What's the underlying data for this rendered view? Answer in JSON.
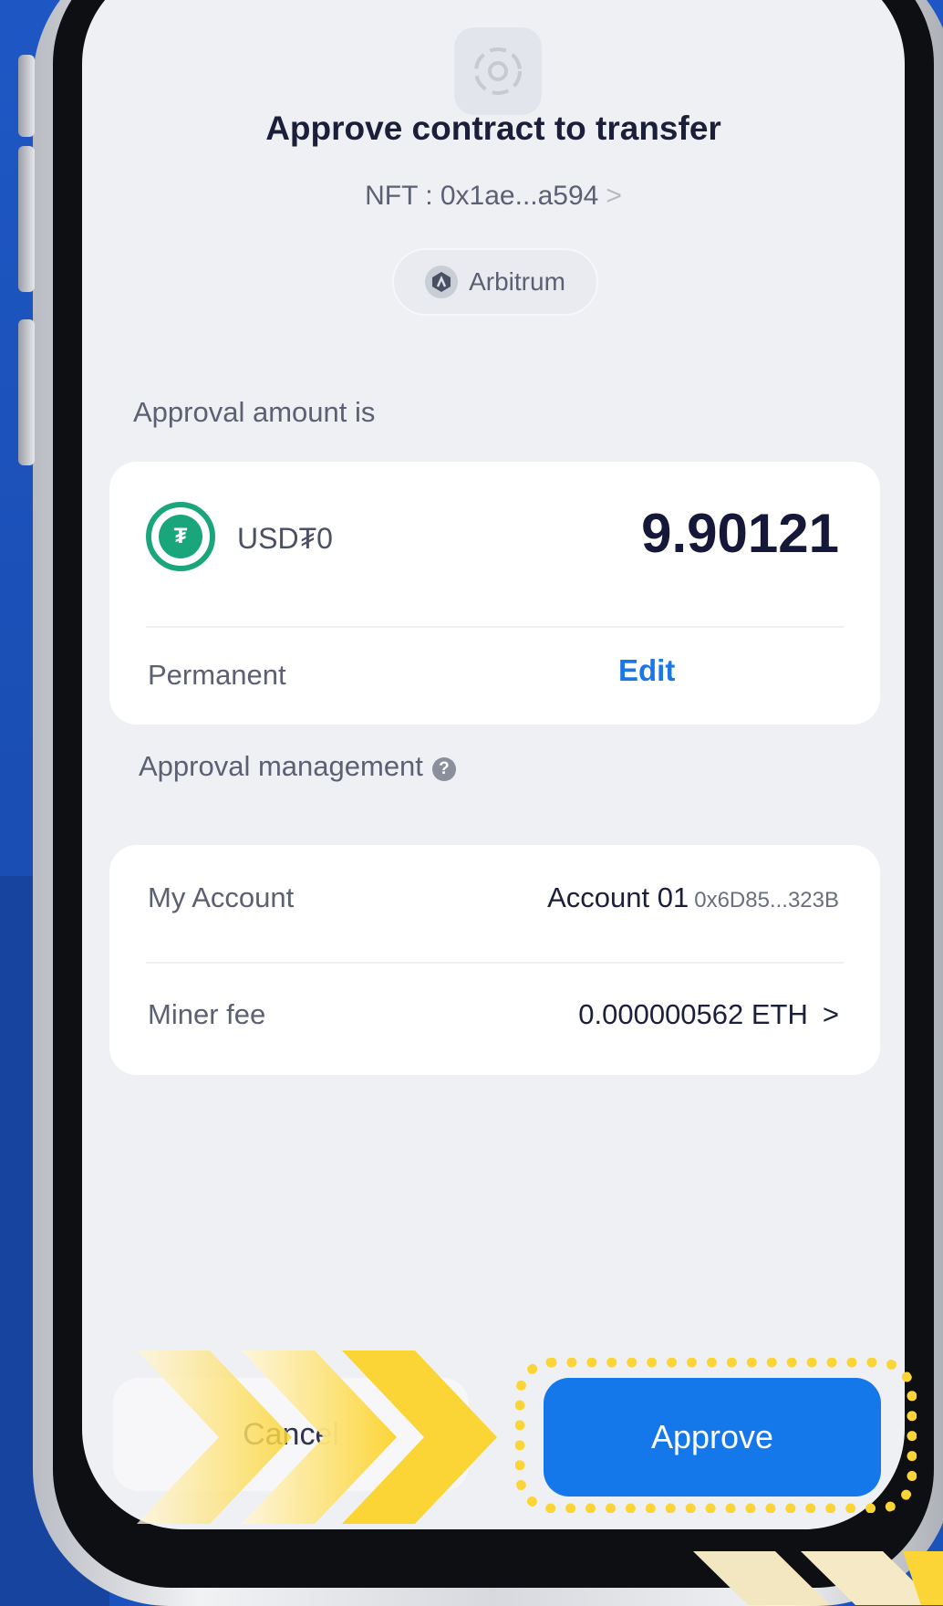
{
  "dialog": {
    "title": "Approve contract to transfer",
    "nft_label": "NFT : 0x1ae...a594",
    "nft_chevron": ">",
    "chain": "Arbitrum"
  },
  "approval": {
    "section_label": "Approval amount is",
    "token_symbol": "USD₮0",
    "amount": "9.90121",
    "duration_label": "Permanent",
    "edit_label": "Edit"
  },
  "management": {
    "section_label": "Approval management",
    "help_icon": "?",
    "account_label": "My Account",
    "account_name": "Account 01",
    "account_address": "0x6D85...323B",
    "fee_label": "Miner fee",
    "fee_value": "0.000000562 ETH",
    "fee_chevron": ">"
  },
  "actions": {
    "cancel_label": "Cancel",
    "approve_label": "Approve"
  },
  "colors": {
    "accent": "#1478ea",
    "highlight": "#fbd536",
    "token_green": "#1aa67b",
    "background": "#1d53b8"
  }
}
